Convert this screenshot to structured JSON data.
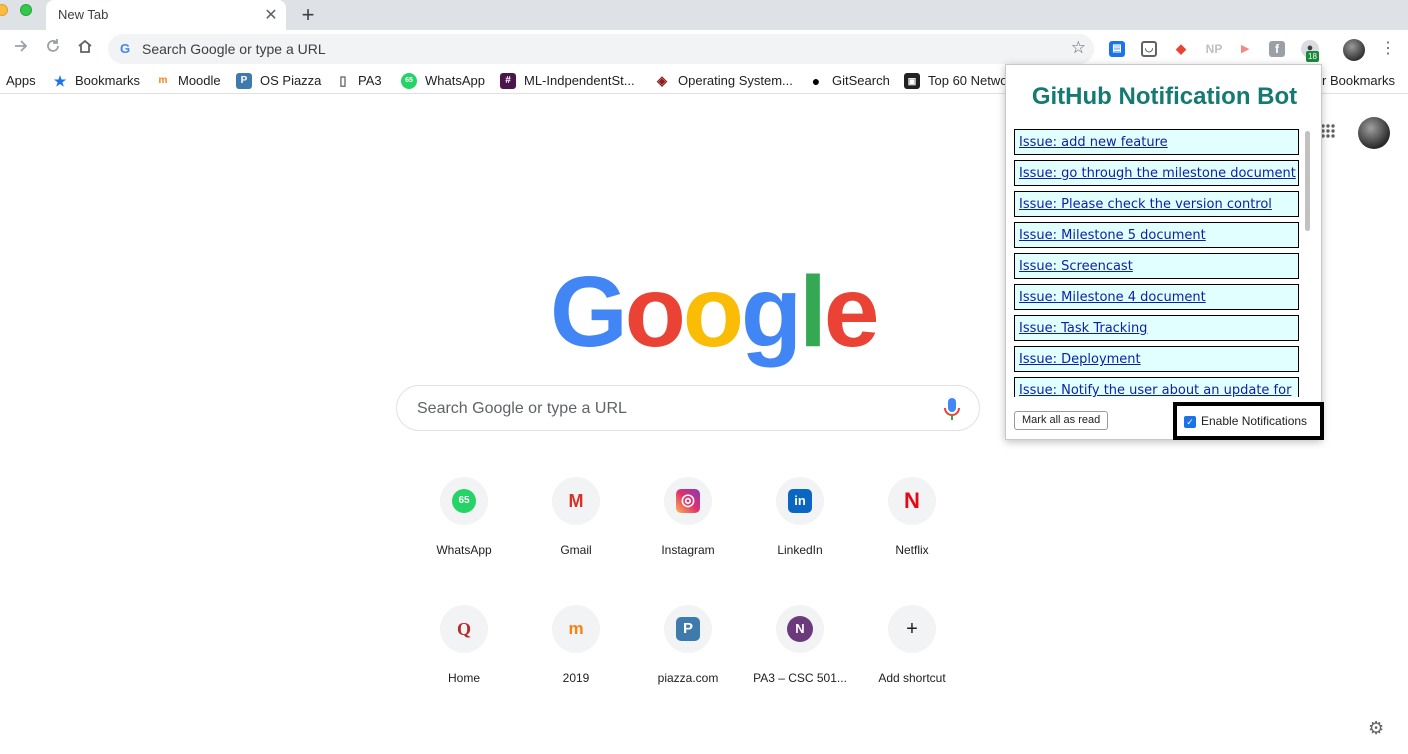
{
  "browser": {
    "tab": {
      "title": "New Tab",
      "close_glyph": "✕"
    },
    "new_tab_glyph": "+",
    "omnibox": {
      "placeholder": "Search Google or type a URL",
      "g_glyph": "G"
    },
    "extensions": [
      {
        "name": "reader-extension-icon",
        "glyph": "▤",
        "color": "#1a73e8"
      },
      {
        "name": "pocket-extension-icon",
        "glyph": "◡",
        "color": "#5f6368"
      },
      {
        "name": "shield-extension-icon",
        "glyph": "◆",
        "color": "#ea4335"
      },
      {
        "name": "np-extension-icon",
        "glyph": "NP",
        "color": "#c0c0c0"
      },
      {
        "name": "cast-extension-icon",
        "glyph": "▸",
        "color": "#f28b82"
      },
      {
        "name": "facebook-extension-icon",
        "glyph": "f",
        "color": "#9aa0a6"
      },
      {
        "name": "github-bot-extension-icon",
        "glyph": "●",
        "color": "#3c4043"
      }
    ],
    "extension_badge": "18",
    "menu_glyph": "⋮",
    "bookmarks": [
      {
        "label": "Apps"
      },
      {
        "label": "Bookmarks",
        "icon": "★"
      },
      {
        "label": "Moodle",
        "icon": "m"
      },
      {
        "label": "OS Piazza",
        "icon": "P"
      },
      {
        "label": "PA3",
        "icon": "▯"
      },
      {
        "label": "WhatsApp",
        "icon": "65"
      },
      {
        "label": "ML-IndpendentSt...",
        "icon": "#"
      },
      {
        "label": "Operating System...",
        "icon": "◈"
      },
      {
        "label": "GitSearch",
        "icon": "●"
      },
      {
        "label": "Top 60 Netwo",
        "icon": "▣"
      }
    ],
    "other_bookmarks": "r Bookmarks"
  },
  "page": {
    "search_placeholder": "Search Google or type a URL",
    "shortcuts": [
      {
        "label": "WhatsApp",
        "glyph": "65"
      },
      {
        "label": "Gmail",
        "glyph": "M"
      },
      {
        "label": "Instagram",
        "glyph": "◎"
      },
      {
        "label": "LinkedIn",
        "glyph": "in"
      },
      {
        "label": "Netflix",
        "glyph": "N"
      },
      {
        "label": "Home",
        "glyph": "Q"
      },
      {
        "label": "2019",
        "glyph": "m"
      },
      {
        "label": "piazza.com",
        "glyph": "P"
      },
      {
        "label": "PA3 – CSC 501...",
        "glyph": "N"
      },
      {
        "label": "Add shortcut",
        "glyph": "+"
      }
    ]
  },
  "popup": {
    "title": "GitHub Notification Bot",
    "issues": [
      "Issue: add new feature",
      "Issue: go through the milestone document",
      "Issue: Please check the version control",
      "Issue: Milestone 5 document",
      "Issue: Screencast",
      "Issue: Milestone 4 document",
      "Issue: Task Tracking",
      "Issue: Deployment",
      "Issue: Notify the user about an update for"
    ],
    "mark_all_label": "Mark all as read",
    "enable_notifications_label": "Enable Notifications",
    "enable_notifications_checked": true
  },
  "colors": {
    "popup_title": "#147a72",
    "issue_bg": "#e1ffff",
    "issue_link": "#0b1fa8",
    "google_blue": "#4285f4",
    "google_red": "#ea4335",
    "google_yellow": "#fbbc05",
    "google_green": "#34a853"
  }
}
